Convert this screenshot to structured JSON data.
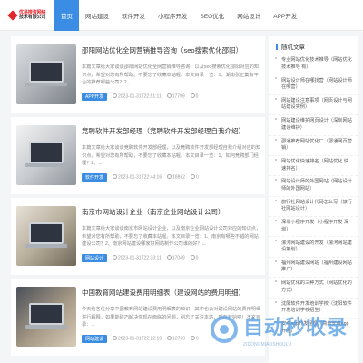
{
  "logo": {
    "line1": "优易搜资网络",
    "line2": "技术有限公司"
  },
  "nav": [
    "首页",
    "网站建设",
    "软件开发",
    "小程序开发",
    "SEO优化",
    "网站设计",
    "APP开发"
  ],
  "articles": [
    {
      "title": "邵阳网站优化全网营销推导咨询（seo搜索优化邵阳）",
      "desc": "本篇文章给大家谈谈邵阳网站优化全网营销推导咨询，以及seo搜索优化邵阳对应的知识点，希望对您有所帮助。不要忘了收藏本站喔。本文目录一览：1、湖南张正集有平台的推荐哪些公司？2、...",
      "tag": "APP开发",
      "date": "2023-01-31T22:51:11",
      "views": "17799",
      "comments": "0"
    },
    {
      "title": "竞聘软件开发部经理（竞聘软件开发部经理自我介绍）",
      "desc": "本篇文章给大家谈谈竞聘软件开发部经理，以及竞聘软件开发部经理自我介绍对应的知识点，希望对您有所帮助，不要忘了收藏本站喔。本文目录一览：1、如何竞聘部门经理？2、...",
      "tag": "软件开发",
      "date": "2023-01-31T22:44:16",
      "views": "18862",
      "comments": "0"
    },
    {
      "title": "南京市网站设计企业（南京企业网站设计公司）",
      "desc": "本篇文章给大家谈谈南京市网站设计企业，以及南京企业网站设计公司对应的知识点，希望对您有所帮助，不要忘了收藏本站喔。本文目录一览：1、南京有哪些不错的网站建设公司？2、南京网站建设哪家好网站制作公司谁的好？...",
      "tag": "网站设计",
      "date": "2023-01-31T22:33:11",
      "views": "17049",
      "comments": "0"
    },
    {
      "title": "中国教育网站建设费用明细表（建设网站的费用明细）",
      "desc": "今天给各位分享中国教育网站建设费用明细表的知识，其中也会对建设网站的费用明细进行解释，如果能碰巧解决你现在面临的问题，别忘了关注本站，现在开始吧！本文目录：...",
      "tag": "网站建设",
      "date": "2023-01-31T22:22:10",
      "views": "12760",
      "comments": "0"
    }
  ],
  "sidebar": {
    "title": "随机文章",
    "items": [
      "专业网站优化技术推导（网站优化技术推导 有）",
      "网站设计师在哪找营（网站设计师在哪营）",
      "网站建设注意事项（网页设计与网站建设实例）",
      "网站建设维护网页设计（深圳网站建设维护）",
      "邵通推荐网站优化厂（邵通网页营销）",
      "网站优化快速排名（网站优化 快速排名）",
      "网站设计师的外国网站（网站设计师的外国网站）",
      "旅行社网站设计代码怎么写（旅行社网站设计）",
      "深圳小程序开发（小程序开发 深圳）",
      "漯河网站建设的开发（漯河网站建设策划）",
      "福州网站建设网站（福州建设网站推广）",
      "网站优化的三种方式（网站优化的方式）",
      "沈阳软件开发培训学校（沈阳软件开发培训学校招生）",
      "安卓app开发经理（简单安卓app开发）"
    ]
  },
  "watermark": {
    "main": "自动秒收录",
    "sub": "ZIDONGMIAOSHOULU"
  }
}
